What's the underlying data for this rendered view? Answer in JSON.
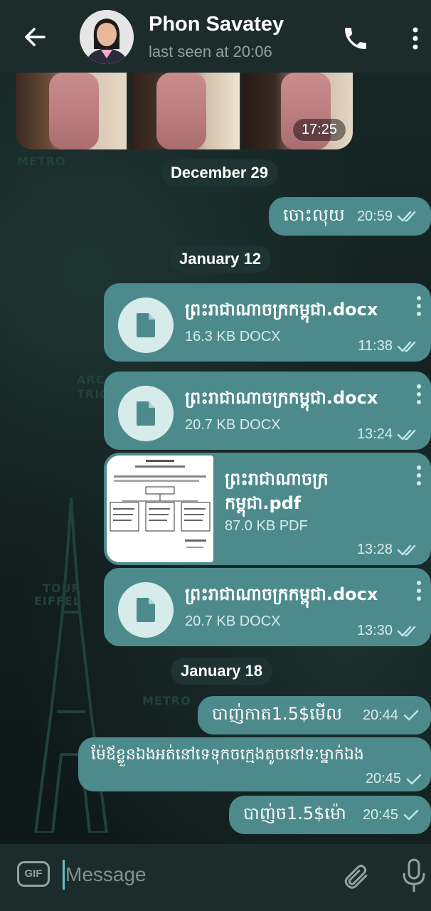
{
  "header": {
    "contact_name": "Phon Savatey",
    "status": "last seen at 20:06"
  },
  "photo_album": {
    "time": "17:25"
  },
  "dates": {
    "d1": "December 29",
    "d2": "January 12",
    "d3": "January 18"
  },
  "messages": {
    "m1": {
      "text": "ចោះលុយ",
      "time": "20:59"
    },
    "f1": {
      "name": "ព្រះរាជាណាចក្រកម្ពុជា.docx",
      "size": "16.3 KB DOCX",
      "time": "11:38"
    },
    "f2": {
      "name": "ព្រះរាជាណាចក្រកម្ពុជា.docx",
      "size": "20.7 KB DOCX",
      "time": "13:24"
    },
    "p1": {
      "name_line1": "ព្រះរាជាណាចក្រ",
      "name_line2": "កម្ពុជា.pdf",
      "size": "87.0 KB PDF",
      "time": "13:28"
    },
    "f3": {
      "name": "ព្រះរាជាណាចក្រកម្ពុជា.docx",
      "size": "20.7 KB DOCX",
      "time": "13:30"
    },
    "m2": {
      "text": "បាញ់កាត1.5$មើល",
      "time": "20:44"
    },
    "m3": {
      "text": "ម៉ែឪខ្លួនឯងអត់នៅទេទុកចក្មេងតូចនៅទៈម្នាក់ឯង",
      "time": "20:45"
    },
    "m4": {
      "text": "បាញ់ច1.5$ម៉ោ",
      "time": "20:45"
    }
  },
  "input": {
    "gif_label": "GIF",
    "placeholder": "Message"
  },
  "wallpaper": {
    "w1": "METRO",
    "w2": "ARC DE",
    "w3": "TRIOMPHE",
    "w4": "TOUR",
    "w5": "EIFFEL",
    "w6": "METRO"
  },
  "colors": {
    "bubble": "#4d8a8c",
    "header": "#1b2c2b",
    "accent": "#5bc4c6"
  }
}
